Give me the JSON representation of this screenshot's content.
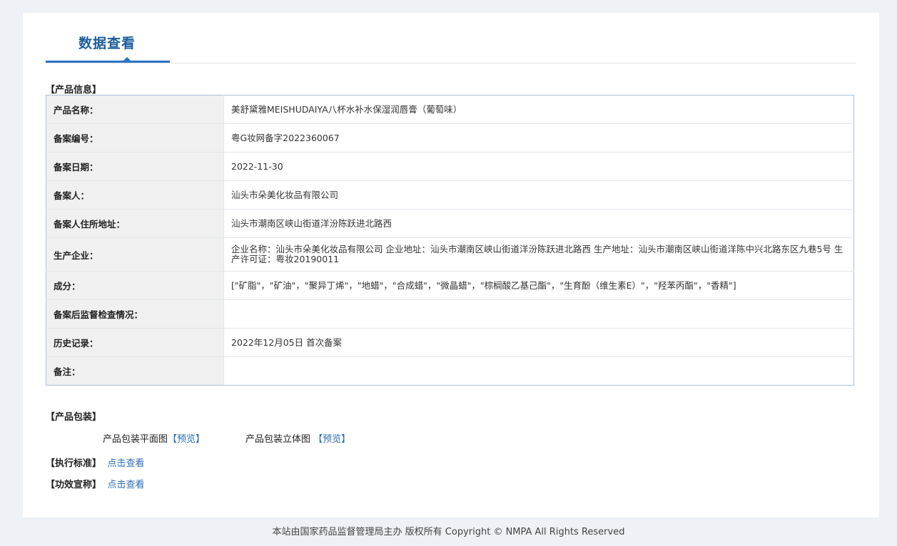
{
  "page_title": "数据查看",
  "product_info": {
    "section_title": "【产品信息】",
    "rows": [
      {
        "label": "产品名称：",
        "value": "美舒黛雅MEISHUDAIYA八杯水补水保湿润唇膏（葡萄味）"
      },
      {
        "label": "备案编号：",
        "value": "粤G妆网备字2022360067"
      },
      {
        "label": "备案日期：",
        "value": "2022-11-30"
      },
      {
        "label": "备案人：",
        "value": "汕头市朵美化妆品有限公司"
      },
      {
        "label": "备案人住所地址：",
        "value": "汕头市潮南区峡山街道洋汾陈跃进北路西"
      },
      {
        "label": "生产企业：",
        "value": "企业名称：汕头市朵美化妆品有限公司 企业地址：汕头市潮南区峡山街道洋汾陈跃进北路西 生产地址：汕头市潮南区峡山街道洋陈中兴北路东区九巷5号 生产许可证：粤妆20190011"
      },
      {
        "label": "成分：",
        "value": "[\"矿脂\"，\"矿油\"，\"聚异丁烯\"，\"地蜡\"，\"合成蜡\"，\"微晶蜡\"，\"棕榈酸乙基己酯\"，\"生育酚（维生素E）\"，\"羟苯丙酯\"，\"香精\"]"
      },
      {
        "label": "备案后监督检查情况：",
        "value": ""
      },
      {
        "label": "历史记录：",
        "value": "2022年12月05日 首次备案"
      },
      {
        "label": "备注：",
        "value": ""
      }
    ]
  },
  "packaging": {
    "section_title": "【产品包装】",
    "flat_label": "产品包装平面图",
    "flat_link": "【预览】",
    "solid_label": "产品包装立体图",
    "solid_link": "【预览】"
  },
  "standard": {
    "title": "【执行标准】",
    "link": "点击查看"
  },
  "efficacy": {
    "title": "【功效宣称】",
    "link": "点击查看"
  },
  "footer": "本站由国家药品监督管理局主办 版权所有 Copyright © NMPA All Rights Reserved"
}
